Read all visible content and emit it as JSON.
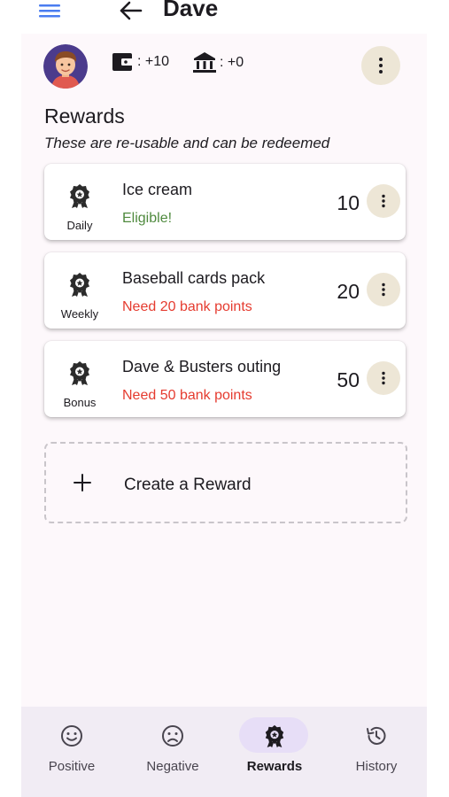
{
  "header": {
    "title": "Dave"
  },
  "stats": {
    "wallet": ": +10",
    "bank": ": +0"
  },
  "rewards_section": {
    "title": "Rewards",
    "subtitle": "These are re-usable and can be redeemed"
  },
  "rewards": [
    {
      "frequency": "Daily",
      "name": "Ice cream",
      "status": "Eligible!",
      "status_color": "#4f8a3e",
      "points": "10"
    },
    {
      "frequency": "Weekly",
      "name": "Baseball cards pack",
      "status": "Need 20 bank points",
      "status_color": "#e53b2f",
      "points": "20"
    },
    {
      "frequency": "Bonus",
      "name": "Dave & Busters outing",
      "status": "Need 50 bank points",
      "status_color": "#e53b2f",
      "points": "50"
    }
  ],
  "create": {
    "label": "Create a Reward"
  },
  "nav": [
    {
      "label": "Positive",
      "icon": "smile-icon",
      "active": false
    },
    {
      "label": "Negative",
      "icon": "frown-icon",
      "active": false
    },
    {
      "label": "Rewards",
      "icon": "award-icon",
      "active": true
    },
    {
      "label": "History",
      "icon": "history-icon",
      "active": false
    }
  ],
  "colors": {
    "accent": "#4a7cf0",
    "pill": "#e7def7",
    "kebab_bg": "#ede6d6"
  }
}
